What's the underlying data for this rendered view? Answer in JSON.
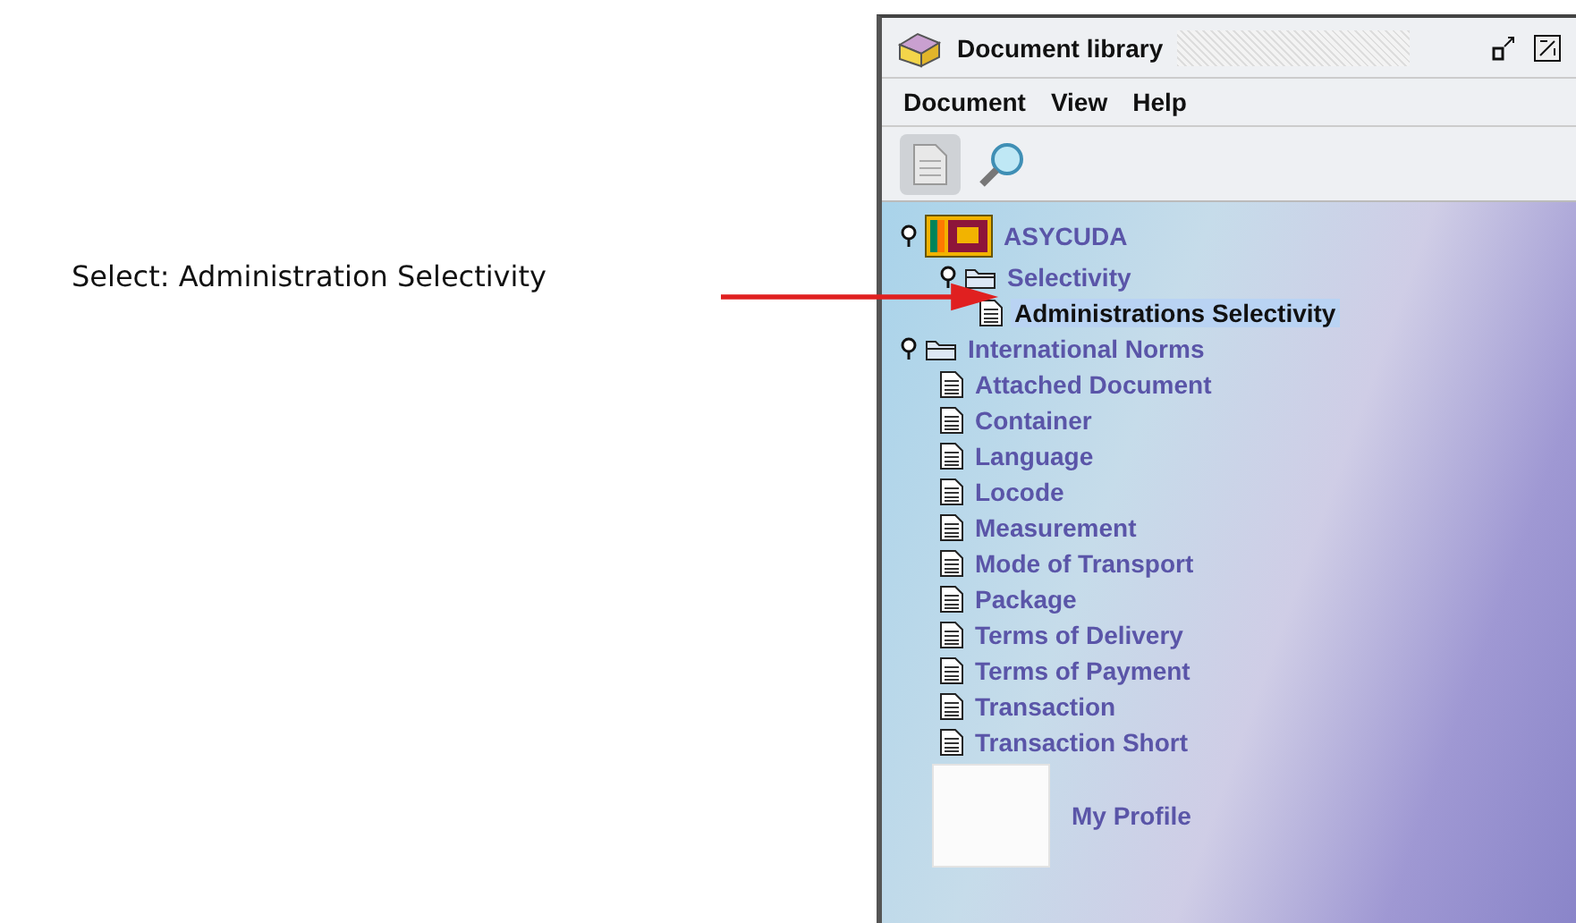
{
  "caption": "Select: Administration Selectivity",
  "window": {
    "title": "Document library"
  },
  "menu": [
    "Document",
    "View",
    "Help"
  ],
  "tree": [
    {
      "label": "ASYCUDA",
      "kind": "flag",
      "expanded": true,
      "selected": false,
      "children": [
        {
          "label": "Selectivity",
          "kind": "folder",
          "expanded": true,
          "selected": false,
          "children": [
            {
              "label": "Administrations Selectivity",
              "kind": "document",
              "selected": true
            }
          ]
        }
      ]
    },
    {
      "label": "International Norms",
      "kind": "folder",
      "expanded": true,
      "selected": false,
      "children": [
        {
          "label": "Attached Document",
          "kind": "document",
          "selected": false
        },
        {
          "label": "Container",
          "kind": "document",
          "selected": false
        },
        {
          "label": "Language",
          "kind": "document",
          "selected": false
        },
        {
          "label": "Locode",
          "kind": "document",
          "selected": false
        },
        {
          "label": "Measurement",
          "kind": "document",
          "selected": false
        },
        {
          "label": "Mode of Transport",
          "kind": "document",
          "selected": false
        },
        {
          "label": "Package",
          "kind": "document",
          "selected": false
        },
        {
          "label": "Terms of Delivery",
          "kind": "document",
          "selected": false
        },
        {
          "label": "Terms of Payment",
          "kind": "document",
          "selected": false
        },
        {
          "label": "Transaction",
          "kind": "document",
          "selected": false
        },
        {
          "label": "Transaction Short",
          "kind": "document",
          "selected": false
        }
      ]
    },
    {
      "label": "My Profile",
      "kind": "profile",
      "selected": false
    }
  ]
}
